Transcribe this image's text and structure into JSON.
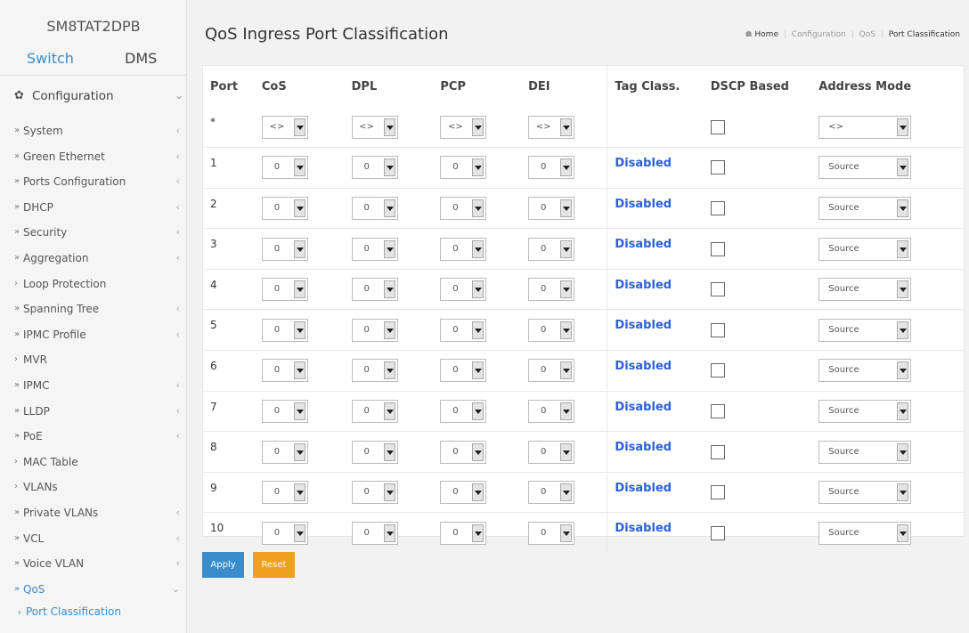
{
  "sidebar": {
    "title": "SM8TAT2DPB",
    "tabs": [
      {
        "label": "Switch"
      },
      {
        "label": "DMS"
      }
    ],
    "section": {
      "label": "Configuration",
      "icon": "gear-icon"
    },
    "items": [
      {
        "label": "System",
        "indicator": "»",
        "arrow": "‹"
      },
      {
        "label": "Green Ethernet",
        "indicator": "»",
        "arrow": "‹"
      },
      {
        "label": "Ports Configuration",
        "indicator": "»",
        "arrow": "‹"
      },
      {
        "label": "DHCP",
        "indicator": "»",
        "arrow": "‹"
      },
      {
        "label": "Security",
        "indicator": "»",
        "arrow": "‹"
      },
      {
        "label": "Aggregation",
        "indicator": "»",
        "arrow": "‹"
      },
      {
        "label": "Loop Protection",
        "indicator": "›",
        "arrow": ""
      },
      {
        "label": "Spanning Tree",
        "indicator": "»",
        "arrow": "‹"
      },
      {
        "label": "IPMC Profile",
        "indicator": "»",
        "arrow": "‹"
      },
      {
        "label": "MVR",
        "indicator": "›",
        "arrow": ""
      },
      {
        "label": "IPMC",
        "indicator": "»",
        "arrow": "‹"
      },
      {
        "label": "LLDP",
        "indicator": "»",
        "arrow": "‹"
      },
      {
        "label": "PoE",
        "indicator": "»",
        "arrow": "‹"
      },
      {
        "label": "MAC Table",
        "indicator": "›",
        "arrow": ""
      },
      {
        "label": "VLANs",
        "indicator": "›",
        "arrow": ""
      },
      {
        "label": "Private VLANs",
        "indicator": "»",
        "arrow": "‹"
      },
      {
        "label": "VCL",
        "indicator": "»",
        "arrow": "‹"
      },
      {
        "label": "Voice VLAN",
        "indicator": "»",
        "arrow": "‹"
      },
      {
        "label": "QoS",
        "indicator": "»",
        "arrow": "⌄",
        "active": true
      }
    ],
    "sub_item": {
      "label": "Port Classification",
      "indicator": "›"
    }
  },
  "page": {
    "title": "QoS Ingress Port Classification",
    "breadcrumb": {
      "home": "Home",
      "items": [
        "Configuration",
        "QoS"
      ],
      "current": "Port Classification"
    }
  },
  "table": {
    "headers": [
      "Port",
      "CoS",
      "DPL",
      "PCP",
      "DEI",
      "Tag Class.",
      "DSCP Based",
      "Address Mode"
    ],
    "wildcard": {
      "port": "*",
      "cos": "<>",
      "dpl": "<>",
      "pcp": "<>",
      "dei": "<>",
      "address_mode": "<>"
    },
    "rows": [
      {
        "port": "1",
        "cos": "0",
        "dpl": "0",
        "pcp": "0",
        "dei": "0",
        "tag_class": "Disabled",
        "address_mode": "Source"
      },
      {
        "port": "2",
        "cos": "0",
        "dpl": "0",
        "pcp": "0",
        "dei": "0",
        "tag_class": "Disabled",
        "address_mode": "Source"
      },
      {
        "port": "3",
        "cos": "0",
        "dpl": "0",
        "pcp": "0",
        "dei": "0",
        "tag_class": "Disabled",
        "address_mode": "Source"
      },
      {
        "port": "4",
        "cos": "0",
        "dpl": "0",
        "pcp": "0",
        "dei": "0",
        "tag_class": "Disabled",
        "address_mode": "Source"
      },
      {
        "port": "5",
        "cos": "0",
        "dpl": "0",
        "pcp": "0",
        "dei": "0",
        "tag_class": "Disabled",
        "address_mode": "Source"
      },
      {
        "port": "6",
        "cos": "0",
        "dpl": "0",
        "pcp": "0",
        "dei": "0",
        "tag_class": "Disabled",
        "address_mode": "Source"
      },
      {
        "port": "7",
        "cos": "0",
        "dpl": "0",
        "pcp": "0",
        "dei": "0",
        "tag_class": "Disabled",
        "address_mode": "Source"
      },
      {
        "port": "8",
        "cos": "0",
        "dpl": "0",
        "pcp": "0",
        "dei": "0",
        "tag_class": "Disabled",
        "address_mode": "Source"
      },
      {
        "port": "9",
        "cos": "0",
        "dpl": "0",
        "pcp": "0",
        "dei": "0",
        "tag_class": "Disabled",
        "address_mode": "Source"
      },
      {
        "port": "10",
        "cos": "0",
        "dpl": "0",
        "pcp": "0",
        "dei": "0",
        "tag_class": "Disabled",
        "address_mode": "Source"
      }
    ]
  },
  "buttons": {
    "apply": "Apply",
    "reset": "Reset"
  },
  "colors": {
    "accent": "#3a8dcb",
    "reset": "#f0a020",
    "link": "#2b5fd9"
  }
}
